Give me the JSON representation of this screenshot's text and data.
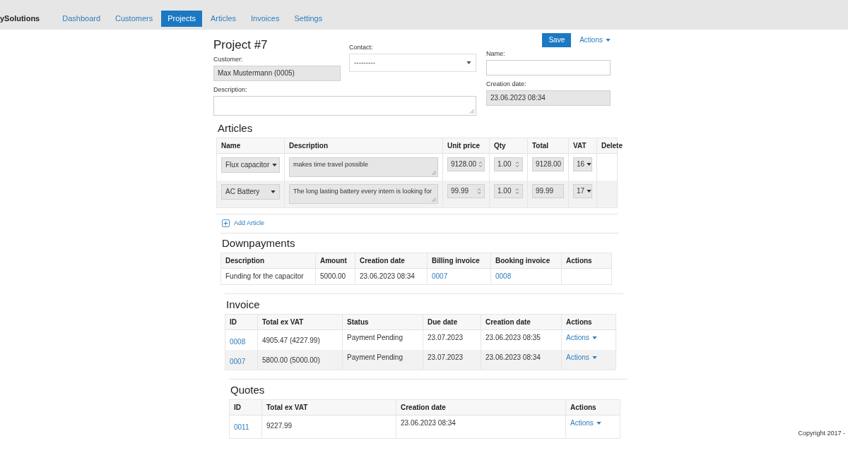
{
  "navbar": {
    "brand": "ySolutions",
    "items": [
      {
        "label": "Dashboard",
        "selected": false
      },
      {
        "label": "Customers",
        "selected": false
      },
      {
        "label": "Projects",
        "selected": true
      },
      {
        "label": "Articles",
        "selected": false
      },
      {
        "label": "Invoices",
        "selected": false
      },
      {
        "label": "Settings",
        "selected": false
      }
    ]
  },
  "toolbar": {
    "save_button": "Save",
    "actions_menu": "Actions"
  },
  "project": {
    "title": "Project #7",
    "customer": {
      "label": "Customer:",
      "value": "Max Mustermann (0005)"
    },
    "contact": {
      "label": "Contact:",
      "value": "---------"
    },
    "name": {
      "label": "Name:"
    },
    "creation_date": {
      "label": "Creation date:",
      "value": "23.06.2023 08:34"
    },
    "description": {
      "label": "Description:"
    }
  },
  "articles": {
    "title": "Articles",
    "columns": [
      "Name",
      "Description",
      "Unit price",
      "Qty",
      "Total",
      "VAT",
      "Delete"
    ],
    "rows": [
      {
        "name": "Flux capacitor",
        "description": "makes time travel possible",
        "unit_price": "9128.00",
        "qty": "1.00",
        "total": "9128.00",
        "vat": "16"
      },
      {
        "name": "AC Battery",
        "description": "The long lasting battery every intern is looking for",
        "unit_price": "99.99",
        "qty": "1.00",
        "total": "99.99",
        "vat": "17"
      }
    ],
    "add_link": "Add Article"
  },
  "downpayments": {
    "title": "Downpayments",
    "columns": [
      "Description",
      "Amount",
      "Creation date",
      "Billing invoice",
      "Booking invoice",
      "Actions"
    ],
    "rows": [
      {
        "description": "Funding for the capacitor",
        "amount": "5000.00",
        "creation_date": "23.06.2023 08:34",
        "billing_invoice": "0007",
        "booking_invoice": "0008"
      }
    ]
  },
  "invoices": {
    "title": "Invoice",
    "columns": [
      "ID",
      "Total ex VAT",
      "Status",
      "Due date",
      "Creation date",
      "Actions"
    ],
    "rows": [
      {
        "id": "0008",
        "total": "4905.47 (4227.99)",
        "status": "Payment Pending",
        "due_date": "23.07.2023",
        "creation_date": "23.06.2023 08:35",
        "actions": "Actions"
      },
      {
        "id": "0007",
        "total": "5800.00 (5000.00)",
        "status": "Payment Pending",
        "due_date": "23.07.2023",
        "creation_date": "23.06.2023 08:34",
        "actions": "Actions"
      }
    ]
  },
  "quotes": {
    "title": "Quotes",
    "columns": [
      "ID",
      "Total ex VAT",
      "Creation date",
      "Actions"
    ],
    "rows": [
      {
        "id": "0011",
        "total": "9227.99",
        "creation_date": "23.06.2023 08:34",
        "actions": "Actions"
      }
    ]
  },
  "footer": {
    "copyright": "Copyright 2017 -"
  }
}
